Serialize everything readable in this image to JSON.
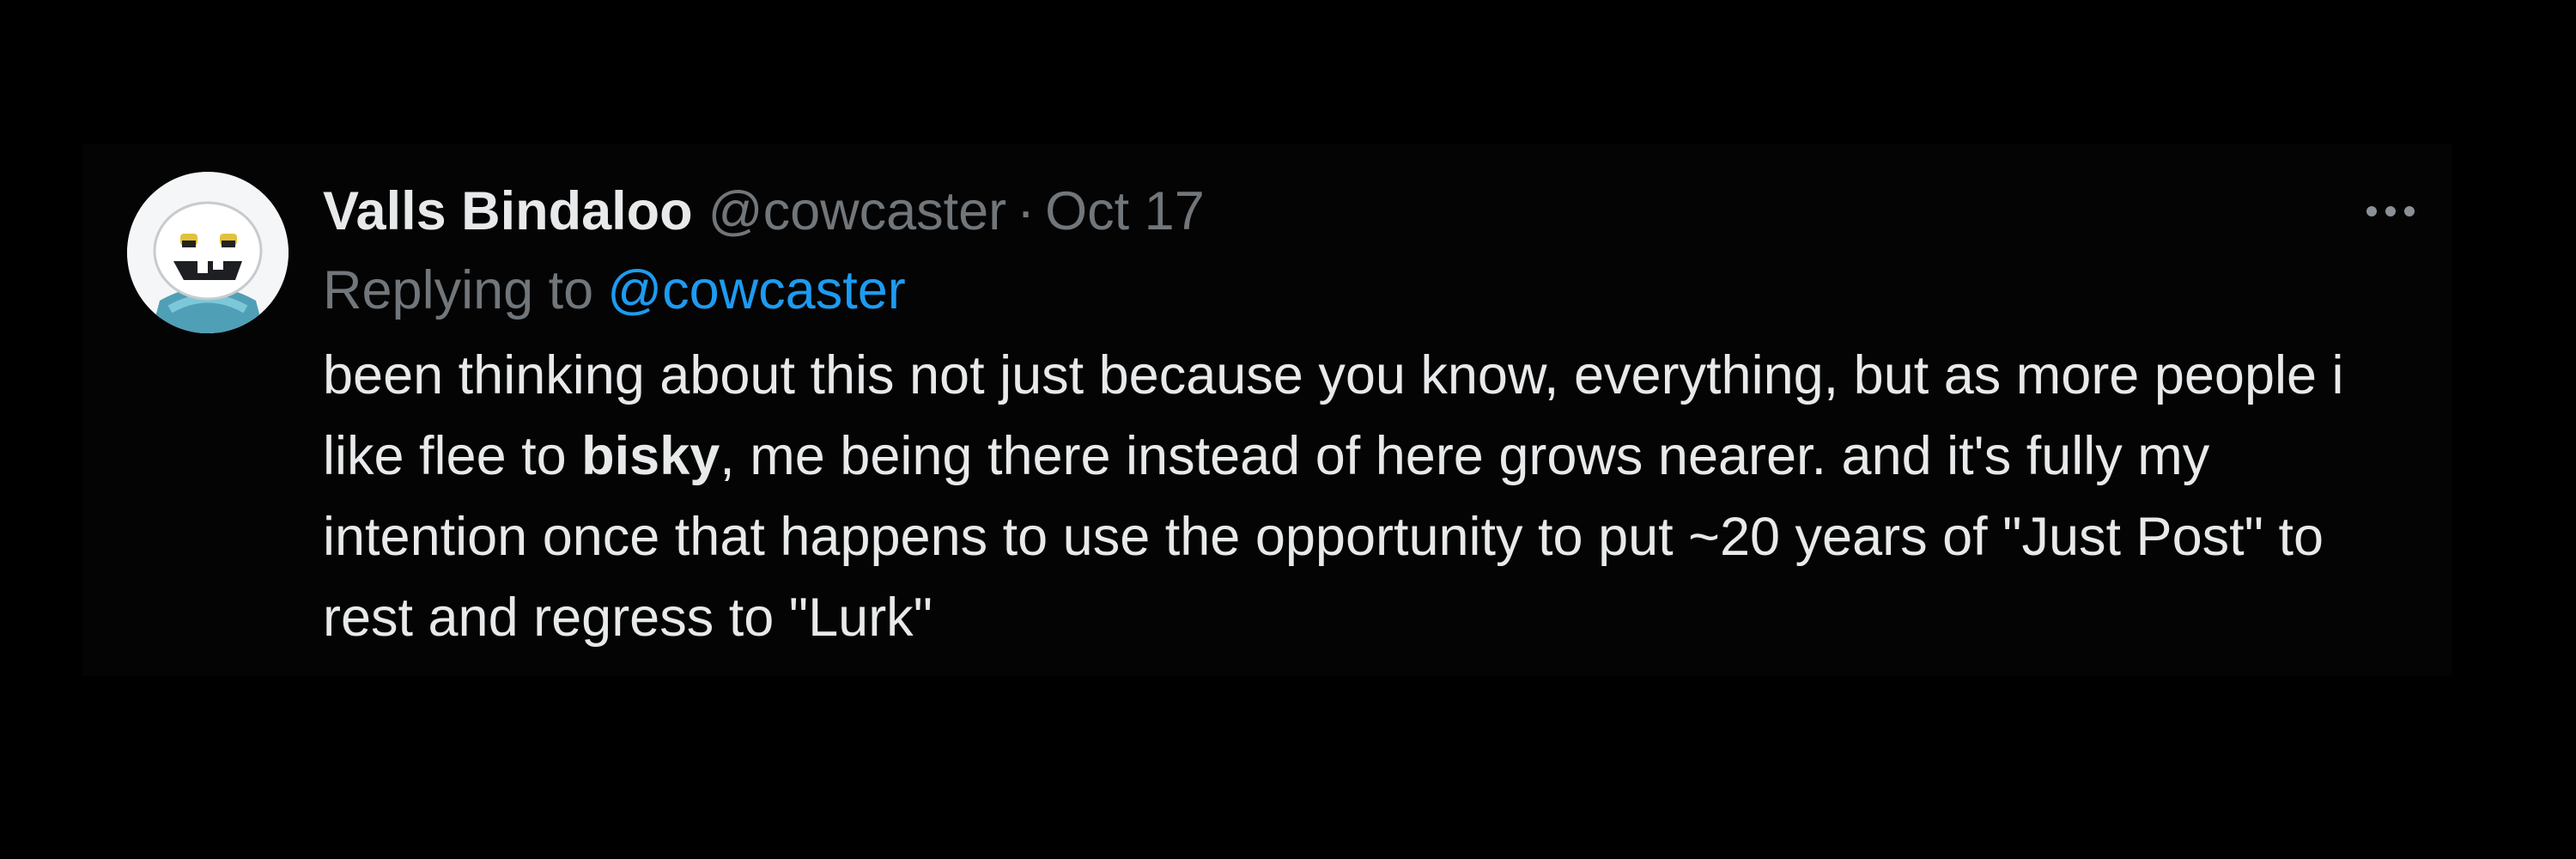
{
  "tweet": {
    "author_name": "Valls Bindaloo",
    "author_handle": "@cowcaster",
    "separator": "·",
    "date": "Oct 17",
    "reply_prefix": "Replying to",
    "reply_mention": "@cowcaster",
    "body_part1": "been thinking about this not just because you know, everything, but as more people i like flee to ",
    "body_bold": "bisky",
    "body_part2": ", me being there instead of here grows nearer. and it's fully my intention once that happens to use the opportunity to put ~20 years of \"Just Post\" to rest and regress to \"Lurk\""
  },
  "icons": {
    "avatar": "snowman-avatar",
    "more": "more-options-icon"
  },
  "colors": {
    "background": "#000000",
    "text_primary": "#e7e9ea",
    "text_secondary": "#71767b",
    "link": "#1d9bf0"
  }
}
